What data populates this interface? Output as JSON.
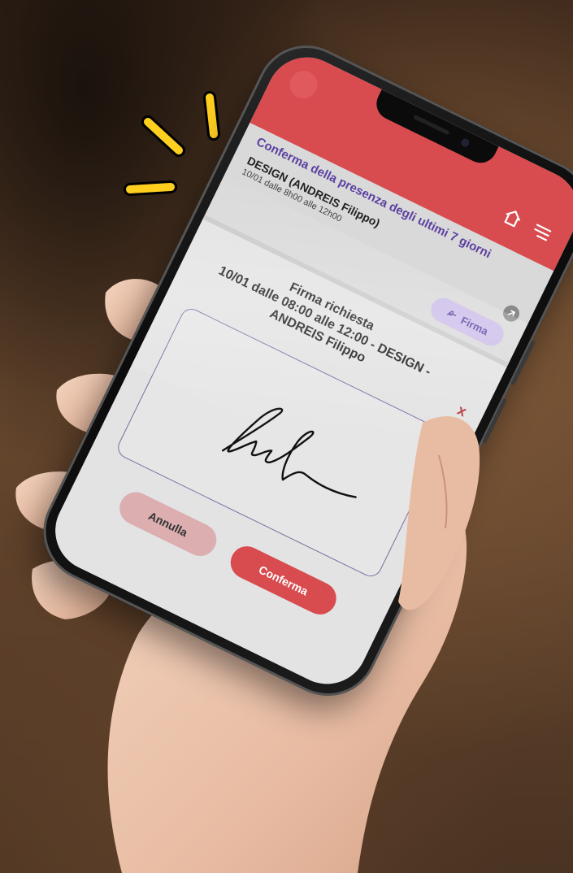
{
  "colors": {
    "header_red": "#d84b4f",
    "accent_purple": "#5b3fa0",
    "firma_chip": "#cbbde9",
    "cancel_pink": "#dcaeb0",
    "burst_yellow": "#ffcf1f"
  },
  "header": {
    "home_icon": "home-icon",
    "menu_icon": "hamburger-menu-icon"
  },
  "section": {
    "title": "Conferma della presenza degli ultimi 7 giorni"
  },
  "item": {
    "title": "DESIGN (ANDREIS Filippo)",
    "subtitle": "10/01 dalle 8h00 alle 12h00",
    "badge_icon": "arrow-up-right-icon",
    "sign_button_label": "Firma",
    "sign_button_icon": "signature-icon"
  },
  "modal": {
    "title_line1": "Firma richiesta",
    "title_line2": "10/01 dalle 08:00 alle 12:00 - DESIGN -",
    "title_line3": "ANDREIS Filippo",
    "close_label": "x",
    "signature_icon": "handwritten-signature",
    "cancel_label": "Annulla",
    "confirm_label": "Conferma"
  }
}
